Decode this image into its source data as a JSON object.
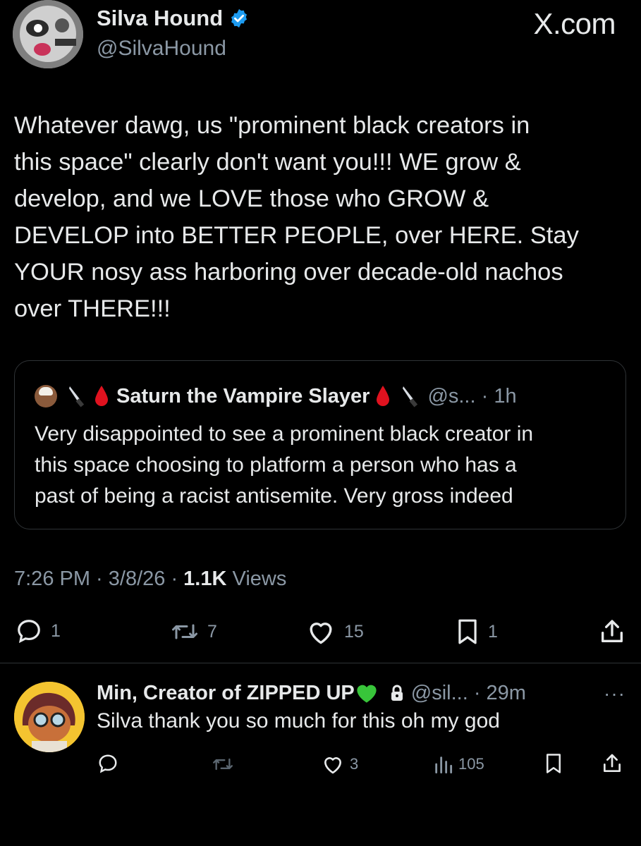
{
  "tweet": {
    "author": {
      "name": "Silva Hound",
      "handle": "@SilvaHound",
      "verified": true,
      "verified_badge_color": "#1d9bf0"
    },
    "watermark": "X.com",
    "text": "Whatever dawg, us \"prominent black creators in\nthis space\" clearly don't want you!!! WE grow &\ndevelop, and we LOVE those who GROW &\nDEVELOP into BETTER PEOPLE, over HERE. Stay\nYOUR nosy ass harboring over decade-old nachos\nover THERE!!!",
    "quote": {
      "prefix_emojis": [
        "avatar",
        "knife-emoji",
        "blood-drop-emoji"
      ],
      "name": "Saturn the Vampire Slayer",
      "suffix_emojis": [
        "blood-drop-emoji",
        "knife-emoji"
      ],
      "handle_time": "@s... · 1h",
      "text": "Very disappointed to see a prominent black creator in\nthis space choosing to platform a person who has a\npast of being a racist antisemite. Very gross indeed"
    },
    "meta": {
      "timestamp": "7:26 PM · 3/8/26 · ",
      "views_count": "1.1K",
      "views_label": " Views"
    },
    "actions": {
      "replies": "1",
      "reposts": "7",
      "likes": "15",
      "bookmarks": "1"
    }
  },
  "reply": {
    "name": "Min, Creator of ZIPPED UP",
    "name_emoji": "green-heart-emoji",
    "lock_icon": "lock-icon",
    "handle_time": "@sil... · 29m",
    "more": "···",
    "text": "Silva thank you so much for this oh my god",
    "actions": {
      "likes": "3",
      "views": "105"
    }
  },
  "colors": {
    "background": "#000000",
    "text": "#e7e9ea",
    "secondary": "#8b98a5",
    "border": "#2f3336",
    "blood": "#e0121f",
    "green_heart": "#38c53a"
  }
}
